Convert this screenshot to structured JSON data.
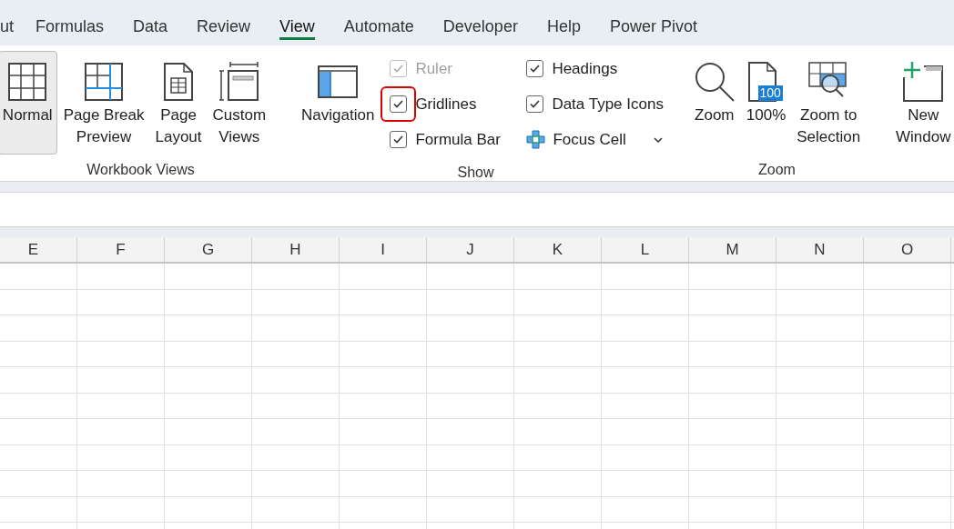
{
  "tabs": [
    {
      "label": "ut",
      "selected": false
    },
    {
      "label": "Formulas",
      "selected": false
    },
    {
      "label": "Data",
      "selected": false
    },
    {
      "label": "Review",
      "selected": false
    },
    {
      "label": "View",
      "selected": true
    },
    {
      "label": "Automate",
      "selected": false
    },
    {
      "label": "Developer",
      "selected": false
    },
    {
      "label": "Help",
      "selected": false
    },
    {
      "label": "Power Pivot",
      "selected": false
    }
  ],
  "workbook_views": {
    "label": "Workbook Views",
    "buttons": [
      {
        "kind": "normal",
        "label": "Normal",
        "selected": true
      },
      {
        "kind": "page-break",
        "label": "Page Break Preview",
        "selected": false
      },
      {
        "kind": "page-layout",
        "label": "Page Layout",
        "selected": false
      },
      {
        "kind": "custom-views",
        "label": "Custom Views",
        "selected": false
      }
    ]
  },
  "show": {
    "label": "Show",
    "navigation": "Navigation",
    "options": [
      {
        "kind": "checkbox",
        "label": "Ruler",
        "checked": true,
        "disabled": true,
        "highlighted": false
      },
      {
        "kind": "checkbox",
        "label": "Gridlines",
        "checked": true,
        "disabled": false,
        "highlighted": true
      },
      {
        "kind": "checkbox",
        "label": "Formula Bar",
        "checked": true,
        "disabled": false,
        "highlighted": false
      },
      {
        "kind": "checkbox",
        "label": "Headings",
        "checked": true,
        "disabled": false,
        "highlighted": false
      },
      {
        "kind": "checkbox",
        "label": "Data Type Icons",
        "checked": true,
        "disabled": false,
        "highlighted": false
      },
      {
        "kind": "focus-cell",
        "label": "Focus Cell",
        "disabled": false,
        "highlighted": false
      }
    ]
  },
  "zoom": {
    "label": "Zoom",
    "buttons": [
      {
        "kind": "zoom",
        "label": "Zoom"
      },
      {
        "kind": "hundred",
        "label": "100%",
        "badge": "100"
      },
      {
        "kind": "zoom-selection",
        "label": "Zoom to Selection"
      }
    ]
  },
  "window": {
    "buttons": [
      {
        "kind": "new-window",
        "label": "New Window"
      }
    ]
  },
  "columns": [
    "E",
    "F",
    "G",
    "H",
    "I",
    "J",
    "K",
    "L",
    "M",
    "N",
    "O"
  ]
}
